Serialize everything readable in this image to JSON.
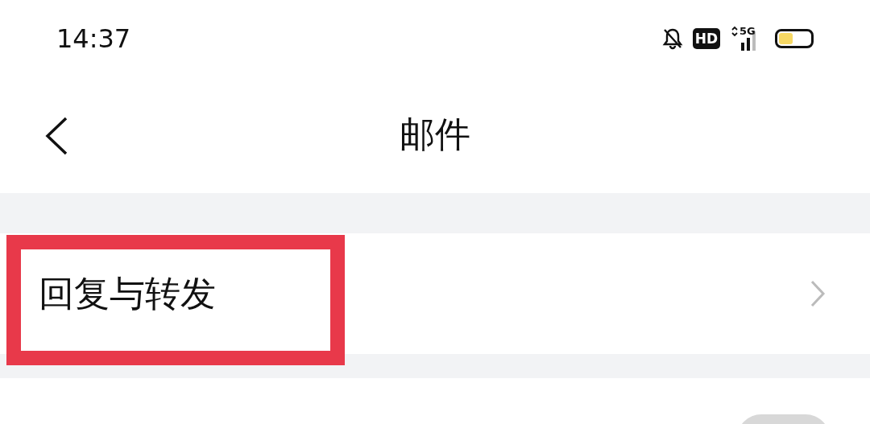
{
  "status_bar": {
    "time": "14:37",
    "hd_badge": "HD",
    "network": "5G"
  },
  "nav": {
    "title": "邮件"
  },
  "rows": [
    {
      "label": "回复与转发",
      "kind": "link",
      "highlighted": true
    }
  ],
  "toggle": {
    "on": false
  }
}
